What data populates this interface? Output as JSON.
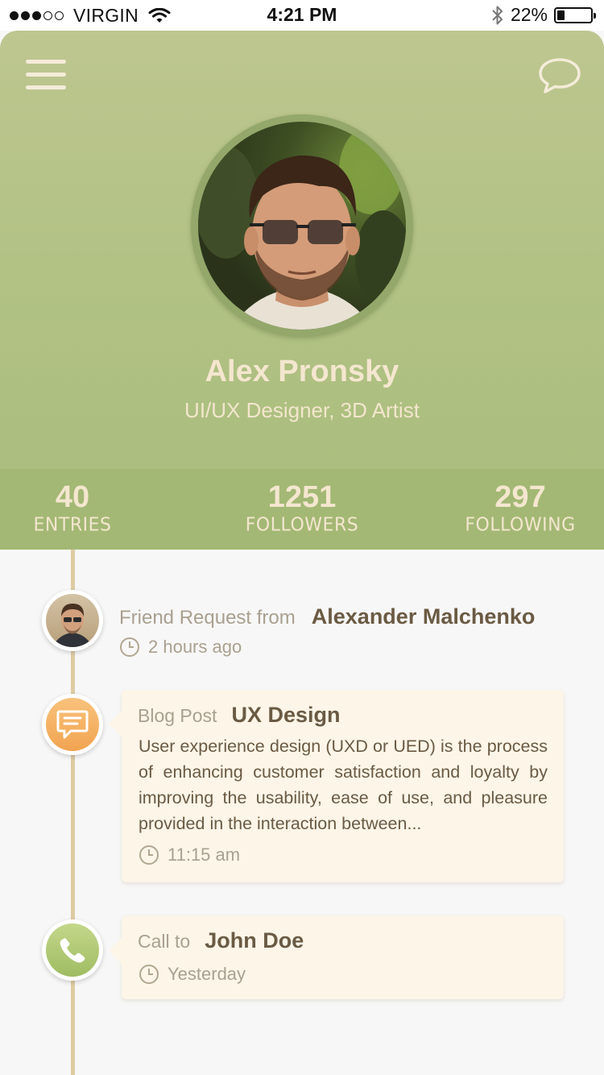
{
  "status_bar": {
    "carrier": "VIRGIN",
    "time": "4:21 PM",
    "battery": "22%",
    "battery_level": 0.22,
    "signal_bars": 3
  },
  "header": {
    "menu_icon": "hamburger-icon",
    "chat_icon": "chat-bubble-icon"
  },
  "profile": {
    "name": "Alex Pronsky",
    "role": "UI/UX Designer, 3D Artist"
  },
  "stats": [
    {
      "value": "40",
      "label": "ENTRIES"
    },
    {
      "value": "1251",
      "label": "FOLLOWERS"
    },
    {
      "value": "297",
      "label": "FOLLOWING"
    }
  ],
  "timeline": {
    "friend_request": {
      "prefix": "Friend Request from",
      "name": "Alexander Malchenko",
      "time": "2 hours ago"
    },
    "blog_post": {
      "prefix": "Blog Post",
      "title": "UX Design",
      "body": "User experience design (UXD or UED) is the process of enhancing customer satisfaction and loyalty by improving the usability, ease of use, and pleasure provided in the interaction between...",
      "time": "11:15 am"
    },
    "call": {
      "prefix": "Call to",
      "name": "John Doe",
      "time": "Yesterday"
    }
  },
  "colors": {
    "header_green": "#b2c285",
    "stats_green": "#a3b874",
    "cream_text": "#f4e6cf",
    "brown_text": "#6b5a43",
    "muted_text": "#aaa08f",
    "card_bg": "#fcf5e8",
    "timeline": "#decba4",
    "blog_orange": "#f1a450",
    "call_green": "#9fbd62"
  }
}
